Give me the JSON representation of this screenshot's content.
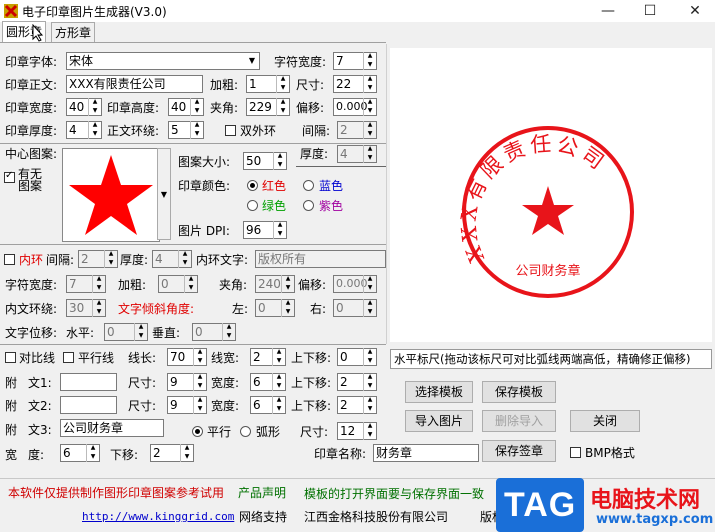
{
  "window": {
    "title": "电子印章图片生成器(V3.0)",
    "minimize": "—",
    "maximize": "☐",
    "close": "✕"
  },
  "tabs": [
    "圆形章",
    "方形章"
  ],
  "seal": {
    "font_label": "印章字体:",
    "font_value": "宋体",
    "char_width_label": "字符宽度:",
    "char_width": "7",
    "text_label": "印章正文:",
    "text_value": "XXX有限责任公司",
    "bold_label": "加粗:",
    "bold": "1",
    "size_label": "尺寸:",
    "size": "22",
    "width_label": "印章宽度:",
    "width": "40",
    "height_label": "印章高度:",
    "height": "40",
    "angle_label": "夹角:",
    "angle": "229",
    "offset_label": "偏移:",
    "offset": "0.000",
    "thickness_label": "印章厚度:",
    "thickness": "4",
    "ring_label": "正文环绕:",
    "ring": "5",
    "double_ring_label": "双外环",
    "gap_label": "间隔:",
    "gap": "2",
    "thick2_label": "厚度:",
    "thick2": "4"
  },
  "center": {
    "label": "中心图案:",
    "has_label": "有无",
    "has_label2": "图案",
    "size_label": "图案大小:",
    "size": "50",
    "color_label": "印章颜色:",
    "colors": [
      "红色",
      "蓝色",
      "绿色",
      "紫色"
    ],
    "dpi_label": "图片 DPI:",
    "dpi": "96"
  },
  "inner": {
    "label": "内环",
    "gap_label": "间隔:",
    "gap": "2",
    "thick_label": "厚度:",
    "thick": "4",
    "text_label": "内环文字:",
    "text": "版权所有",
    "char_width_label": "字符宽度:",
    "char_width": "7",
    "bold_label": "加粗:",
    "bold": "0",
    "angle_label": "夹角:",
    "angle": "240",
    "offset_label": "偏移:",
    "offset": "0.000",
    "ring_label": "内文环绕:",
    "ring": "30",
    "tilt_label": "文字倾斜角度:",
    "left_label": "左:",
    "left": "0",
    "right_label": "右:",
    "right": "0",
    "shift_label": "文字位移:",
    "h_label": "水平:",
    "h": "0",
    "v_label": "垂直:",
    "v": "0"
  },
  "lines": {
    "compare_label": "对比线",
    "parallel_label": "平行线",
    "length_label": "线长:",
    "length": "70",
    "lwidth_label": "线宽:",
    "lwidth": "2",
    "move_label": "上下移:",
    "move": "0"
  },
  "attach": [
    {
      "label1": "附",
      "label2": "文1:",
      "text": "",
      "size_label": "尺寸:",
      "size": "9",
      "width_label": "宽度:",
      "width": "6",
      "move_label": "上下移:",
      "move": "2"
    },
    {
      "label1": "附",
      "label2": "文2:",
      "text": "",
      "size_label": "尺寸:",
      "size": "9",
      "width_label": "宽度:",
      "width": "6",
      "move_label": "上下移:",
      "move": "2"
    }
  ],
  "attach3": {
    "label1": "附",
    "label2": "文3:",
    "text": "公司财务章",
    "flat": "平行",
    "arc": "弧形",
    "size_label": "尺寸:",
    "size": "12"
  },
  "bottom": {
    "width_label1": "宽",
    "width_label2": "度:",
    "width": "6",
    "move_label": "下移:",
    "move": "2",
    "name_label": "印章名称:",
    "name": "财务章",
    "bmp_label": "BMP格式"
  },
  "buttons": {
    "select_template": "选择模板",
    "save_template": "保存模板",
    "import_image": "导入图片",
    "delete_import": "删除导入",
    "close": "关闭",
    "save_seal": "保存签章"
  },
  "ruler": "水平标尺(拖动该标尺可对比弧线两端高低，精确修正偏移)",
  "preview": {
    "ring_text": "XXX有限责任公司",
    "bottom_text": "公司财务章"
  },
  "footer": {
    "line1_red": "本软件仅提供制作图形印章图案参考试用",
    "line1_red2": "产品声明",
    "line1_green": "模板的打开界面要与保存界面一致",
    "url": "http://www.kinggrid.com",
    "support": "网络支持",
    "company": "江西金格科技股份有限公司",
    "tail": "版权"
  },
  "watermark": {
    "tag": "TAG",
    "brand": "电脑技术网",
    "site": "www.tagxp.com"
  },
  "colors": {
    "seal_red": "#e8141a",
    "footer_red": "#d00000",
    "footer_green": "#007000",
    "tag_blue": "#1a6fd8"
  }
}
